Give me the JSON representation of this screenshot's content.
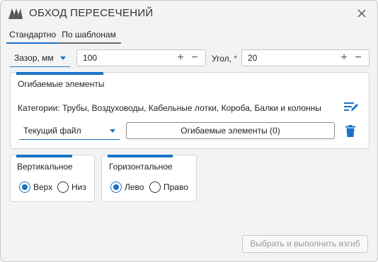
{
  "window": {
    "title": "ОБХОД ПЕРЕСЕЧЕНИЙ"
  },
  "tabs": [
    {
      "label": "Стандартно",
      "active": true
    },
    {
      "label": "По шаблонам",
      "active": false
    }
  ],
  "gap": {
    "select_label": "Зазор, мм",
    "value": "100"
  },
  "angle": {
    "label": "Угол, °",
    "value": "20"
  },
  "bypassed": {
    "title": "Огибаемые элементы",
    "categories_text": "Категории: Трубы, Воздуховоды, Кабельные лотки, Короба, Балки и колонны",
    "source_select": "Текущий файл",
    "elements_button": "Огибаемые элементы (0)"
  },
  "vertical": {
    "title": "Вертикальное",
    "options": [
      {
        "label": "Верх",
        "checked": true
      },
      {
        "label": "Низ",
        "checked": false
      }
    ]
  },
  "horizontal": {
    "title": "Горизонтальное",
    "options": [
      {
        "label": "Лево",
        "checked": true
      },
      {
        "label": "Право",
        "checked": false
      }
    ]
  },
  "action_button": "Выбрать и выполнить изгиб",
  "colors": {
    "accent": "#1a73c7",
    "danger": "#1a73c7"
  },
  "icons": {
    "logo": "app-logo-icon",
    "close": "close-icon",
    "edit": "edit-list-icon",
    "delete": "trash-icon"
  }
}
